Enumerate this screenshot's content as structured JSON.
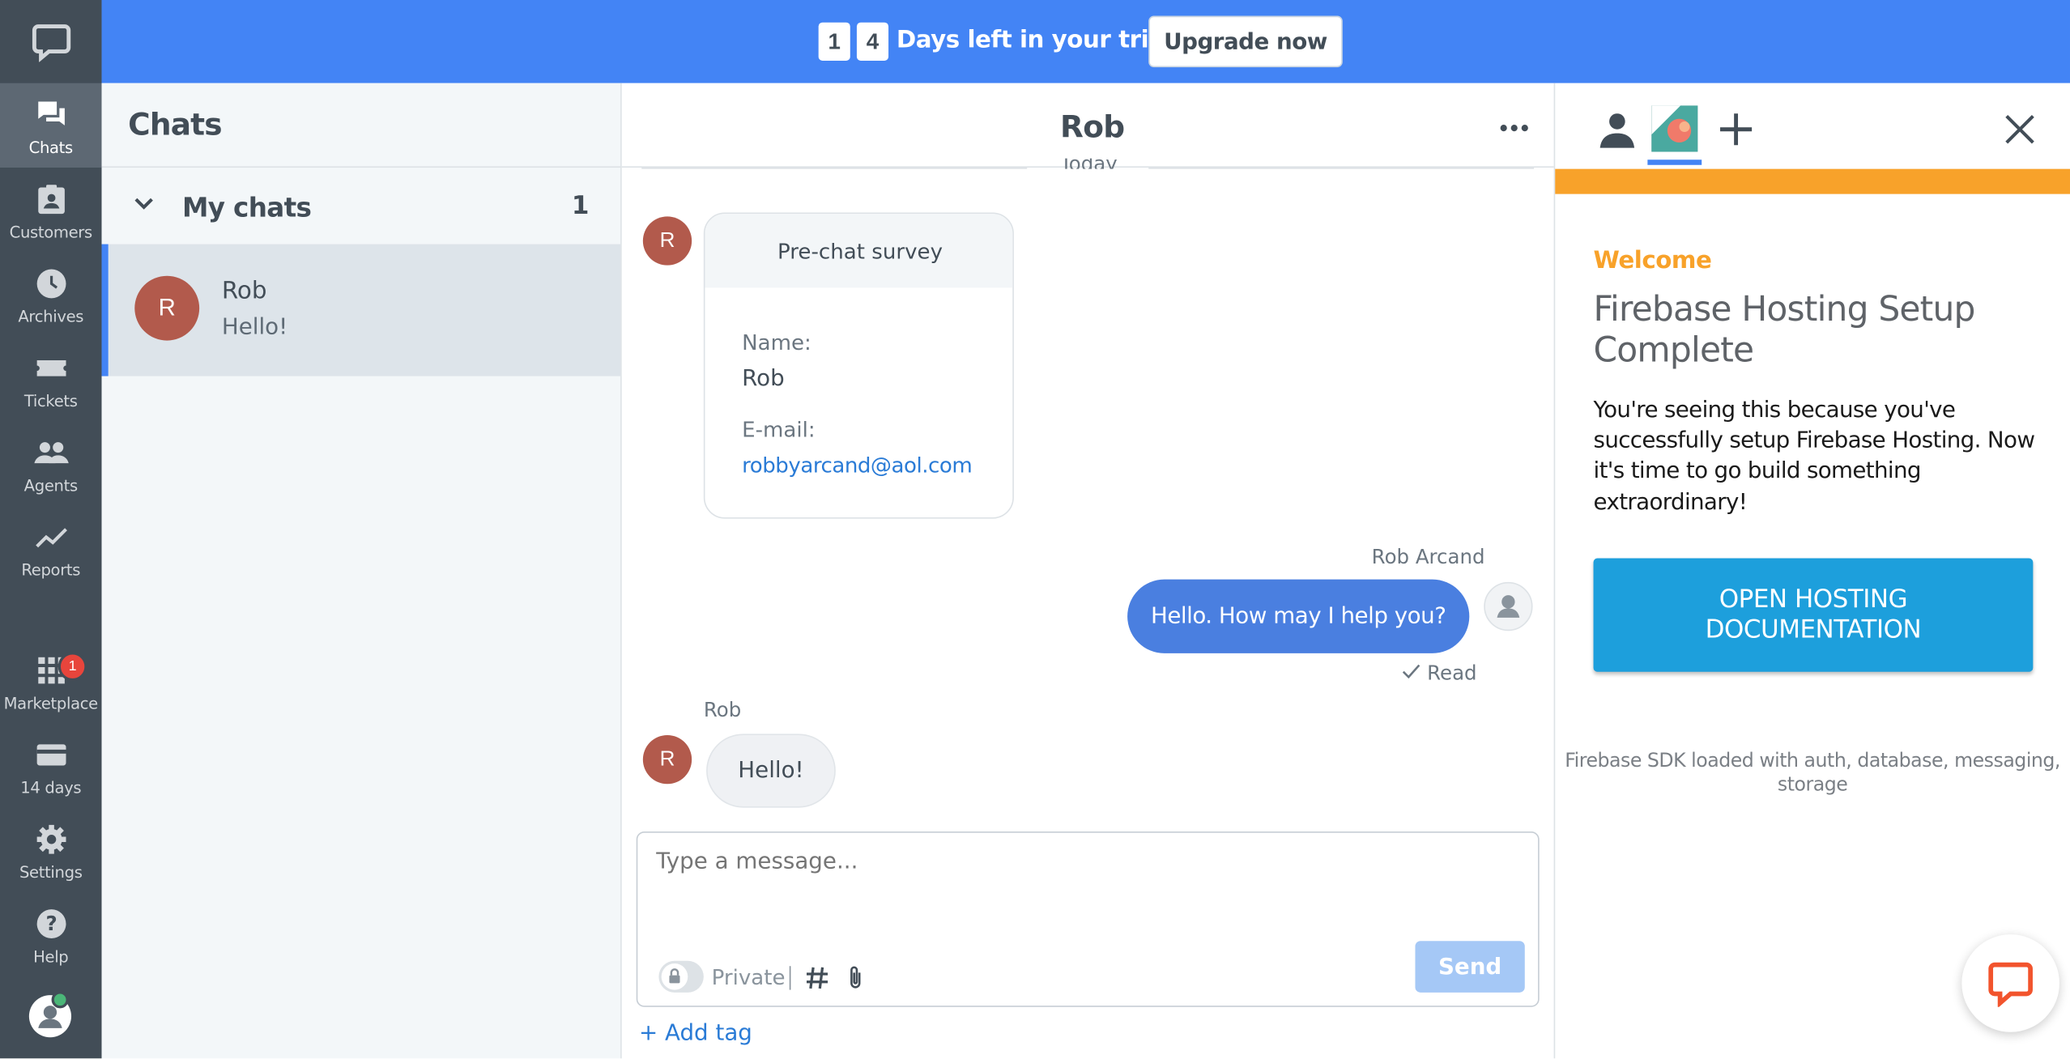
{
  "trial": {
    "digit1": "1",
    "digit2": "4",
    "text": "Days left in your trial.",
    "upgrade": "Upgrade now"
  },
  "nav": {
    "items": [
      {
        "label": "Chats",
        "icon": "chat-bubbles-icon"
      },
      {
        "label": "Customers",
        "icon": "customers-icon"
      },
      {
        "label": "Archives",
        "icon": "clock-icon"
      },
      {
        "label": "Tickets",
        "icon": "ticket-icon"
      },
      {
        "label": "Agents",
        "icon": "agents-icon"
      },
      {
        "label": "Reports",
        "icon": "chart-line-icon"
      },
      {
        "label": "Marketplace",
        "icon": "apps-grid-icon"
      },
      {
        "label": "14 days",
        "icon": "credit-card-icon"
      },
      {
        "label": "Settings",
        "icon": "gear-icon"
      },
      {
        "label": "Help",
        "icon": "help-icon"
      }
    ],
    "marketplace_badge": "1"
  },
  "list": {
    "title": "Chats",
    "section": "My chats",
    "count": "1",
    "chat": {
      "initial": "R",
      "name": "Rob",
      "preview": "Hello!"
    }
  },
  "conversation": {
    "title": "Rob",
    "date_divider": "Today",
    "survey": {
      "title": "Pre-chat survey",
      "name_label": "Name:",
      "name_value": "Rob",
      "email_label": "E-mail:",
      "email_value": "robbyarcand@aol.com"
    },
    "agent_name": "Rob Arcand",
    "agent_message": "Hello. How may I help you?",
    "read_status": "Read",
    "customer_name": "Rob",
    "customer_initial": "R",
    "customer_message": "Hello!"
  },
  "composer": {
    "placeholder": "Type a message...",
    "private_label": "Private",
    "send": "Send",
    "add_tag": "+ Add tag"
  },
  "panel": {
    "welcome": "Welcome",
    "heading_line1": "Firebase Hosting Setup",
    "heading_line2": "Complete",
    "body_lines": [
      "You're seeing this because you've",
      "successfully setup Firebase Hosting. Now",
      "it's time to go build something",
      "extraordinary!"
    ],
    "button_line1": "OPEN HOSTING",
    "button_line2": "DOCUMENTATION",
    "status_line1": "Firebase SDK loaded with auth, database, messaging,",
    "status_line2": "storage"
  },
  "colors": {
    "accent": "#4384f5",
    "nav_bg": "#424d57",
    "avatar": "#b25a4c",
    "panel_orange": "#f8a22a",
    "firebase_button": "#1d9fdc"
  }
}
